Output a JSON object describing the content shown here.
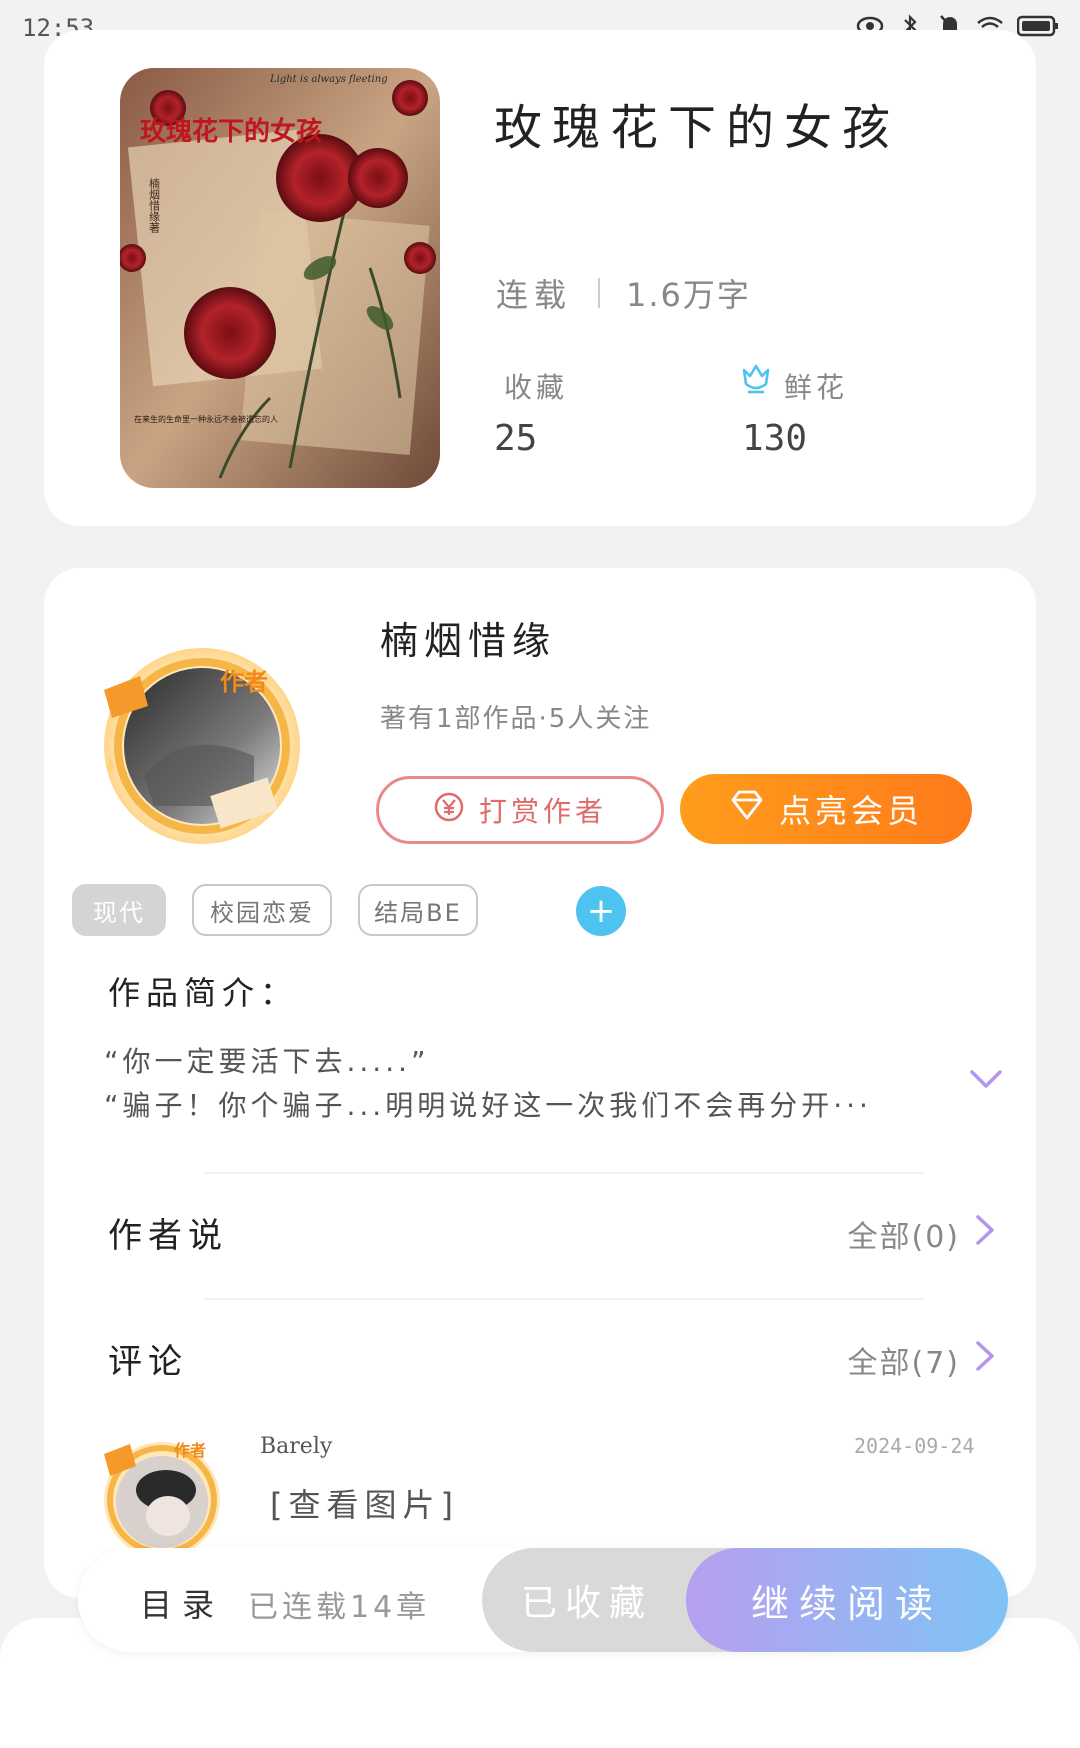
{
  "status_bar": {
    "time": "12:53"
  },
  "book": {
    "title": "玫瑰花下的女孩",
    "status": "连载",
    "word_count": "1.6万字",
    "favorites_label": "收藏",
    "favorites_value": "25",
    "flowers_label": "鲜花",
    "flowers_value": "130",
    "cover": {
      "top_text": "Light is always fleeting",
      "title_text": "玫瑰花下的女孩",
      "side_text": "楠烟惜缘著",
      "bottom_text": "在来生的生命里一种永远不会被遗忘的人"
    }
  },
  "author": {
    "name": "楠烟惜缘",
    "badge": "作者",
    "subtitle": "著有1部作品·5人关注",
    "reward_button": "打赏作者",
    "vip_button": "点亮会员"
  },
  "tags": [
    "现代",
    "校园恋爱",
    "结局BE"
  ],
  "intro": {
    "title": "作品简介：",
    "lines": [
      "“你一定要活下去.....”",
      "“骗子！你个骗子...明明说好这一次我们不会再分开···"
    ]
  },
  "author_says": {
    "title": "作者说",
    "more": "全部(0)"
  },
  "comments": {
    "title": "评论",
    "more": "全部(7)",
    "item": {
      "user": "Barely",
      "badge": "作者",
      "date": "2024-09-24",
      "text": "[查看图片]"
    }
  },
  "bottom_bar": {
    "toc": "目录",
    "chapters": "已连载14章",
    "collected": "已收藏",
    "read": "继续阅读"
  },
  "colors": {
    "accent_orange": "#ff8c1a",
    "accent_cyan": "#4fc3ef",
    "accent_purple": "#b79ff0",
    "reward_red": "#e06b6b"
  }
}
